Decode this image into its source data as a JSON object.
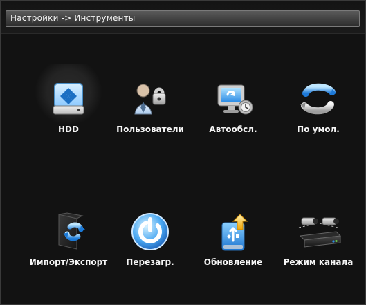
{
  "window": {
    "title": "Настройки -> Инструменты"
  },
  "tools": [
    {
      "id": "hdd",
      "label": "HDD",
      "icon": "hdd-icon"
    },
    {
      "id": "users",
      "label": "Пользователи",
      "icon": "users-lock-icon"
    },
    {
      "id": "autobase",
      "label": "Автообсл.",
      "icon": "maintenance-monitor-icon"
    },
    {
      "id": "defaults",
      "label": "По умол.",
      "icon": "restore-defaults-icon"
    },
    {
      "id": "import",
      "label": "Импорт/Экспорт",
      "icon": "import-export-icon"
    },
    {
      "id": "reboot",
      "label": "Перезагр.",
      "icon": "power-reboot-icon"
    },
    {
      "id": "update",
      "label": "Обновление",
      "icon": "usb-update-icon"
    },
    {
      "id": "channel",
      "label": "Режим канала",
      "icon": "camera-dvr-icon"
    }
  ],
  "colors": {
    "background": "#121212",
    "title_bar": "#2c2c2c",
    "text": "#f5f5f5"
  }
}
